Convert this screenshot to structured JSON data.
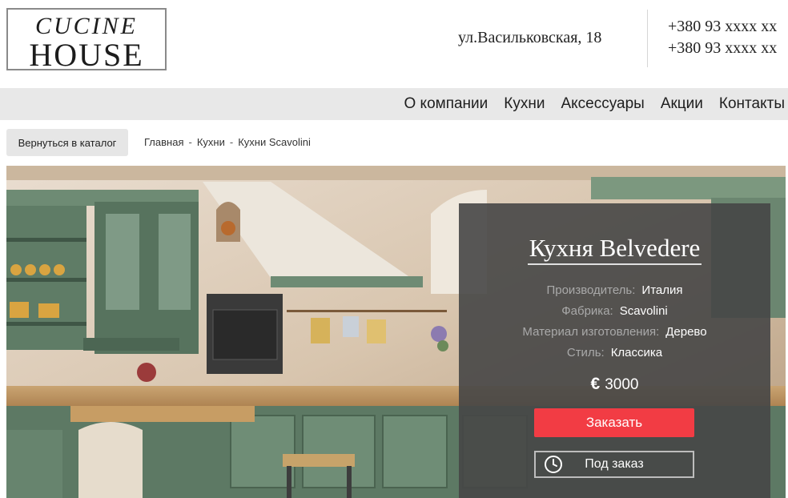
{
  "logo": {
    "line1": "CUCINE",
    "line2": "HOUSE"
  },
  "header": {
    "address": "ул.Васильковская, 18",
    "phones": [
      "+380 93 xxxx xx",
      "+380 93 xxxx xx"
    ]
  },
  "nav": {
    "items": [
      "О компании",
      "Кухни",
      "Аксессуары",
      "Акции",
      "Контакты"
    ]
  },
  "breadcrumb": {
    "back_label": "Вернуться в каталог",
    "items": [
      "Главная",
      "Кухни",
      "Кухни Scavolini"
    ],
    "separator": "-"
  },
  "product": {
    "title": "Кухня Belvedere",
    "specs": [
      {
        "label": "Производитель:",
        "value": "Италия"
      },
      {
        "label": "Фабрика:",
        "value": "Scavolini"
      },
      {
        "label": "Материал изготовления:",
        "value": "Дерево"
      },
      {
        "label": "Стиль:",
        "value": "Классика"
      }
    ],
    "currency_symbol": "€",
    "price": "3000",
    "order_label": "Заказать",
    "custom_label": "Под заказ"
  },
  "colors": {
    "accent": "#f23c44",
    "nav_bg": "#e8e8e8",
    "panel_bg": "#464646",
    "cabinet_green": "#5f7c66"
  },
  "icons": {
    "custom_order": "clock-icon"
  }
}
